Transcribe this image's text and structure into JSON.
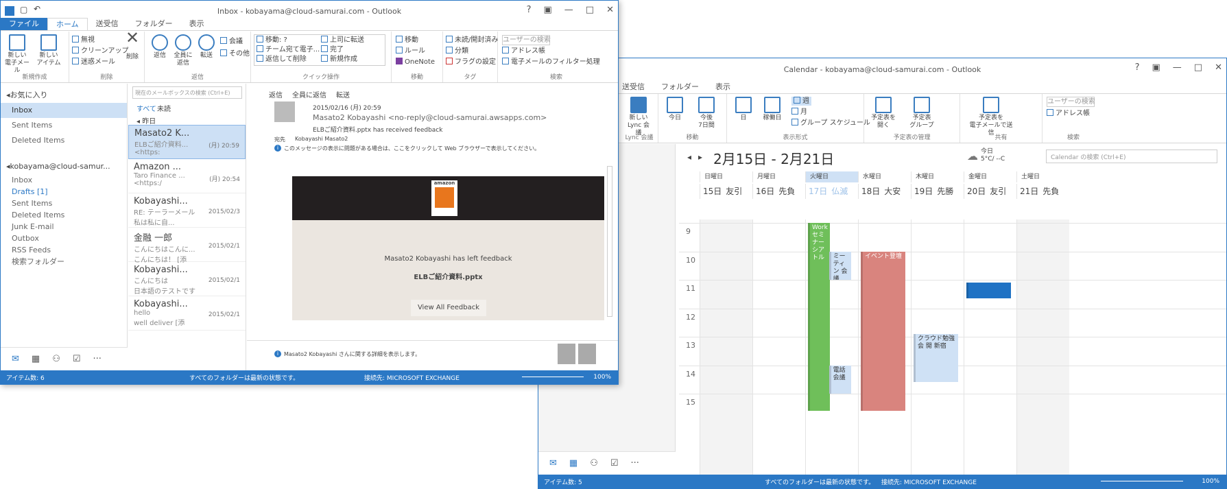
{
  "inbox_window": {
    "title": "Inbox - kobayama@cloud-samurai.com - Outlook",
    "controls": [
      "?",
      "▣",
      "—",
      "□",
      "✕"
    ],
    "tabs": [
      {
        "label": "ファイル",
        "state": "file"
      },
      {
        "label": "ホーム",
        "state": "active"
      },
      {
        "label": "送受信",
        "state": ""
      },
      {
        "label": "フォルダー",
        "state": ""
      },
      {
        "label": "表示",
        "state": ""
      }
    ],
    "ribbon": {
      "new_email": "新しい\n電子メール",
      "new_items": "新しい\nアイテム",
      "ignore": "無視",
      "cleanup": "クリーンアップ",
      "junk": "迷惑メール",
      "delete": "削除",
      "reply": "返信",
      "reply_all": "全員に\n返信",
      "forward": "転送",
      "meeting": "会議",
      "more": "その他",
      "quick_steps": [
        "移動: ?",
        "チーム宛て電子...",
        "返信して削除",
        "上司に転送",
        "完了",
        "新規作成"
      ],
      "move": "移動",
      "rules": "ルール",
      "onenote": "OneNote",
      "unread": "未読/開封済み",
      "categorize": "分類",
      "followup": "フラグの設定",
      "search_people": "ユーザーの検索",
      "address_book": "アドレス帳",
      "filter_email": "電子メールのフィルター処理",
      "group_labels": [
        "新規作成",
        "削除",
        "返信",
        "クイック操作",
        "移動",
        "タグ",
        "検索"
      ]
    },
    "folders": {
      "favorites_header": "◂お気に入り",
      "favorites": [
        "Inbox",
        "Sent Items",
        "Deleted Items"
      ],
      "account_header": "◂kobayama@cloud-samur...",
      "account": [
        "Inbox",
        "Drafts [1]",
        "Sent Items",
        "Deleted Items",
        "Junk E-mail",
        "Outbox",
        "RSS Feeds",
        "検索フォルダー"
      ]
    },
    "search_placeholder": "現在のメールボックスの検索 (Ctrl+E)",
    "filters": {
      "all": "すべて",
      "unread": "未読",
      "today": "◂ 昨日"
    },
    "messages": [
      {
        "sender": "Masato2 K...",
        "subject": "ELBご紹介資料...",
        "preview": "<https:",
        "date": "(月) 20:59"
      },
      {
        "sender": "Amazon ...",
        "subject": "Taro Finance ...",
        "preview": "<https:/",
        "date": "(月) 20:54"
      },
      {
        "sender": "Kobayashi...",
        "subject": "RE: テーラーメール",
        "preview": "私は私に自...",
        "date": "2015/02/3"
      },
      {
        "sender": "金融 一郎",
        "subject": "こんにちはこんに...",
        "preview": "こんにちは！ [添",
        "date": "2015/02/1"
      },
      {
        "sender": "Kobayashi...",
        "subject": "こんにちは",
        "preview": "日本語のテストです",
        "date": "2015/02/1"
      },
      {
        "sender": "Kobayashi...",
        "subject": "hello",
        "preview": "well deliver [添",
        "date": "2015/02/1"
      }
    ],
    "reading": {
      "actions": [
        "返信",
        "全員に返信",
        "転送"
      ],
      "date": "2015/02/16 (月) 20:59",
      "from": "Masato2 Kobayashi <no-reply@cloud-samurai.awsapps.com>",
      "subject": "ELBご紹介資料.pptx has received feedback",
      "to_label": "宛先",
      "to": "Kobayashi Masato2",
      "infobar": "このメッセージの表示に問題がある場合は、ここをクリックして Web ブラウザーで表示してください。",
      "logo_text": "amazon",
      "body_line1": "Masato2 Kobayashi has left feedback",
      "body_line2": "ELBご紹介資料.pptx",
      "button": "View All Feedback",
      "people_bar": "Masato2 Kobayashi さんに関する詳細を表示します。"
    },
    "status": {
      "items": "アイテム数: 6",
      "sync": "すべてのフォルダーは最新の状態です。",
      "conn": "接続先: MICROSOFT EXCHANGE",
      "zoom": "100%"
    }
  },
  "calendar_window": {
    "title": "Calendar - kobayama@cloud-samurai.com - Outlook",
    "controls": [
      "?",
      "▣",
      "—",
      "□",
      "✕"
    ],
    "tabs": [
      {
        "label": "送受信",
        "state": ""
      },
      {
        "label": "フォルダー",
        "state": ""
      },
      {
        "label": "表示",
        "state": ""
      }
    ],
    "ribbon": {
      "lync": "新しい\nLync 会議",
      "today": "今日",
      "next7": "今後\n7日間",
      "day": "日",
      "workweek": "稼働日",
      "week": "週",
      "month": "月",
      "schedule": "グループ スケジュール",
      "open_cal": "予定表を\n開く",
      "cal_groups": "予定表\nグループ",
      "email_cal": "予定表を\n電子メールで送信",
      "search_people": "ユーザーの検索",
      "address_book": "アドレス帳",
      "group_labels": [
        "Lync 会議",
        "移動",
        "表示形式",
        "予定表の管理",
        "共有",
        "検索"
      ]
    },
    "range": "2月15日 - 2月21日",
    "weather": "今日\n5°C/ --C",
    "search_placeholder": "Calendar の検索 (Ctrl+E)",
    "day_names": [
      "日曜日",
      "月曜日",
      "火曜日",
      "水曜日",
      "木曜日",
      "金曜日",
      "土曜日"
    ],
    "days": [
      {
        "num": "15日",
        "rokuyo": "友引"
      },
      {
        "num": "16日",
        "rokuyo": "先負"
      },
      {
        "num": "17日",
        "rokuyo": "仏滅"
      },
      {
        "num": "18日",
        "rokuyo": "大安"
      },
      {
        "num": "19日",
        "rokuyo": "先勝"
      },
      {
        "num": "20日",
        "rokuyo": "友引"
      },
      {
        "num": "21日",
        "rokuyo": "先負"
      }
    ],
    "hours": [
      "9",
      "10",
      "11",
      "12",
      "13",
      "14",
      "15"
    ],
    "events": [
      {
        "text": "Work セミナー シアトル",
        "day": 2,
        "start": 9.0,
        "end": 15.6,
        "color": "#6fbf5a",
        "text_color": "#fff"
      },
      {
        "text": "ミーティン 会議",
        "day": 2.45,
        "start": 10.0,
        "end": 11.0,
        "color": "#cfe1f5",
        "text_color": "#333"
      },
      {
        "text": "電話 会議",
        "day": 2.45,
        "start": 14.0,
        "end": 15.0,
        "color": "#cfe1f5",
        "text_color": "#333"
      },
      {
        "text": "イベント登壇",
        "day": 3,
        "start": 10.0,
        "end": 15.6,
        "color": "#d9847e",
        "text_color": "#fff"
      },
      {
        "text": "クラウド勉強会 開 新宿",
        "day": 4,
        "start": 12.9,
        "end": 14.6,
        "color": "#cfe1f5",
        "text_color": "#333"
      },
      {
        "text": "",
        "day": 5,
        "start": 11.1,
        "end": 11.65,
        "color": "#1f72c4",
        "text_color": "#fff"
      }
    ],
    "status": {
      "items": "アイテム数: 5",
      "sync": "すべてのフォルダーは最新の状態です。",
      "conn": "接続先: MICROSOFT EXCHANGE",
      "zoom": "100%"
    }
  }
}
